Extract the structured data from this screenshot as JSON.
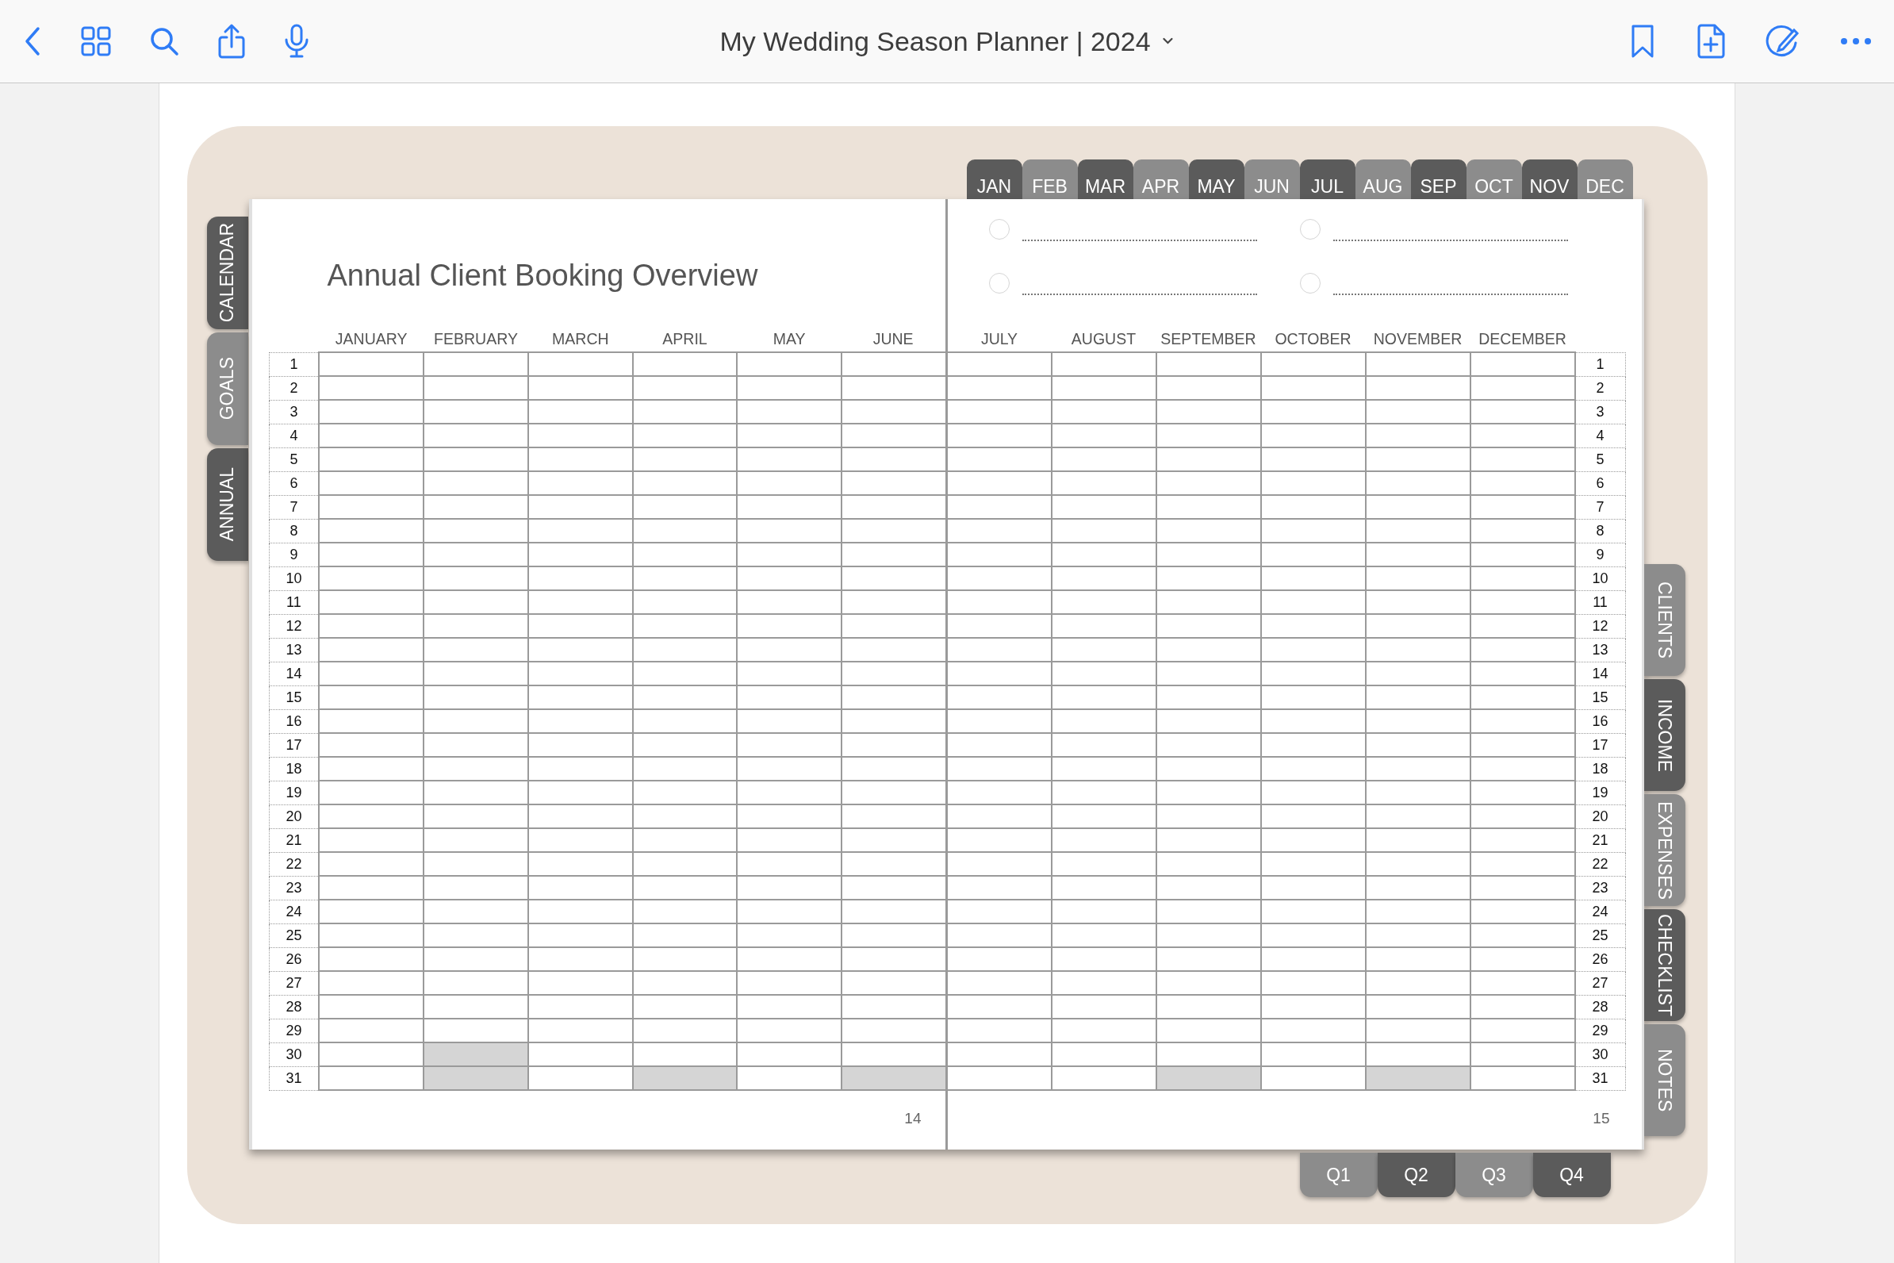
{
  "toolbar": {
    "title": "My Wedding Season Planner | 2024"
  },
  "month_tabs": [
    {
      "label": "JAN",
      "kind": "dark"
    },
    {
      "label": "FEB",
      "kind": "light"
    },
    {
      "label": "MAR",
      "kind": "dark"
    },
    {
      "label": "APR",
      "kind": "light"
    },
    {
      "label": "MAY",
      "kind": "dark"
    },
    {
      "label": "JUN",
      "kind": "light"
    },
    {
      "label": "JUL",
      "kind": "dark"
    },
    {
      "label": "AUG",
      "kind": "light"
    },
    {
      "label": "SEP",
      "kind": "dark"
    },
    {
      "label": "OCT",
      "kind": "light"
    },
    {
      "label": "NOV",
      "kind": "dark"
    },
    {
      "label": "DEC",
      "kind": "light"
    }
  ],
  "left_tabs": [
    {
      "label": "CALENDAR",
      "kind": "dark"
    },
    {
      "label": "GOALS",
      "kind": "light"
    },
    {
      "label": "ANNUAL",
      "kind": "dark"
    }
  ],
  "right_tabs": [
    {
      "label": "CLIENTS",
      "kind": "light"
    },
    {
      "label": "INCOME",
      "kind": "dark"
    },
    {
      "label": "EXPENSES",
      "kind": "light"
    },
    {
      "label": "CHECKLIST",
      "kind": "dark"
    },
    {
      "label": "NOTES",
      "kind": "light"
    }
  ],
  "quarter_tabs": [
    {
      "label": "Q1",
      "kind": "light"
    },
    {
      "label": "Q2",
      "kind": "dark"
    },
    {
      "label": "Q3",
      "kind": "light"
    },
    {
      "label": "Q4",
      "kind": "dark"
    }
  ],
  "left_page": {
    "title": "Annual Client Booking Overview",
    "months": [
      {
        "label": "JANUARY",
        "kind": "full"
      },
      {
        "label": "FEBRUARY",
        "kind": "february"
      },
      {
        "label": "MARCH",
        "kind": "full"
      },
      {
        "label": "APRIL",
        "kind": "thirty"
      },
      {
        "label": "MAY",
        "kind": "full"
      },
      {
        "label": "JUNE",
        "kind": "thirty"
      }
    ],
    "day_numbers": [
      "1",
      "2",
      "3",
      "4",
      "5",
      "6",
      "7",
      "8",
      "9",
      "10",
      "11",
      "12",
      "13",
      "14",
      "15",
      "16",
      "17",
      "18",
      "19",
      "20",
      "21",
      "22",
      "23",
      "24",
      "25",
      "26",
      "27",
      "28",
      "29",
      "30",
      "31"
    ],
    "page_number": "14"
  },
  "right_page": {
    "checklist": [
      {
        "checked": false
      },
      {
        "checked": false
      },
      {
        "checked": false
      },
      {
        "checked": false
      }
    ],
    "months": [
      {
        "label": "JULY",
        "kind": "full"
      },
      {
        "label": "AUGUST",
        "kind": "full"
      },
      {
        "label": "SEPTEMBER",
        "kind": "thirty"
      },
      {
        "label": "OCTOBER",
        "kind": "full"
      },
      {
        "label": "NOVEMBER",
        "kind": "thirty"
      },
      {
        "label": "DECEMBER",
        "kind": "full"
      }
    ],
    "day_numbers": [
      "1",
      "2",
      "3",
      "4",
      "5",
      "6",
      "7",
      "8",
      "9",
      "10",
      "11",
      "12",
      "13",
      "14",
      "15",
      "16",
      "17",
      "18",
      "19",
      "20",
      "21",
      "22",
      "23",
      "24",
      "25",
      "26",
      "27",
      "28",
      "29",
      "30",
      "31"
    ],
    "page_number": "15"
  }
}
